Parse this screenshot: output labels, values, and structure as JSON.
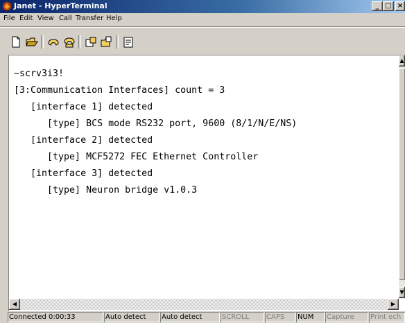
{
  "window": {
    "title": "Janet - HyperTerminal",
    "controls": [
      "minimize-icon",
      "maximize-icon",
      "close-icon"
    ]
  },
  "menu": [
    "File",
    "Edit",
    "View",
    "Call",
    "Transfer",
    "Help"
  ],
  "toolbar": {
    "icons": [
      "new-icon",
      "open-icon",
      "connect-icon",
      "disconnect-icon",
      "send-icon",
      "receive-icon",
      "properties-icon"
    ]
  },
  "terminal": {
    "lines": [
      "~scrv3i3!",
      "[3:Communication Interfaces] count = 3",
      "   [interface 1] detected",
      "      [type] BCS mode RS232 port, 9600 (8/1/N/E/NS)",
      "   [interface 2] detected",
      "      [type] MCF5272 FEC Ethernet Controller",
      "   [interface 3] detected",
      "      [type] Neuron bridge v1.0.3"
    ]
  },
  "status": {
    "connected": "Connected 0:00:33",
    "detect1": "Auto detect",
    "detect2": "Auto detect",
    "scroll": "SCROLL",
    "caps": "CAPS",
    "num": "NUM",
    "capture": "Capture",
    "print": "Print ech"
  },
  "colors": {
    "titlebar": "#0a246a",
    "client_bg": "#ffffff",
    "chrome": "#d4d0c8"
  }
}
